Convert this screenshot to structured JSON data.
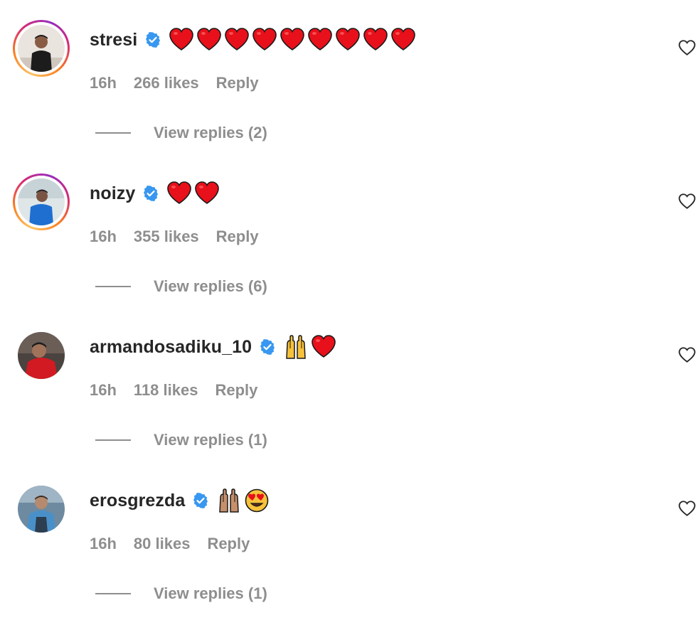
{
  "comments": [
    {
      "username": "stresi",
      "time": "16h",
      "likes": "266 likes",
      "reply": "Reply",
      "view_replies": "View replies (2)",
      "story_ring": true,
      "emojis": [
        "red-heart",
        "red-heart",
        "red-heart",
        "red-heart",
        "red-heart",
        "red-heart",
        "red-heart",
        "red-heart",
        "red-heart"
      ]
    },
    {
      "username": "noizy",
      "time": "16h",
      "likes": "355 likes",
      "reply": "Reply",
      "view_replies": "View replies (6)",
      "story_ring": true,
      "emojis": [
        "red-heart",
        "red-heart"
      ]
    },
    {
      "username": "armandosadiku_10",
      "time": "16h",
      "likes": "118 likes",
      "reply": "Reply",
      "view_replies": "View replies (1)",
      "story_ring": false,
      "emojis": [
        "raising-hands",
        "red-heart"
      ]
    },
    {
      "username": "erosgrezda",
      "time": "16h",
      "likes": "80 likes",
      "reply": "Reply",
      "view_replies": "View replies (1)",
      "story_ring": false,
      "emojis": [
        "raising-hands-medium-skin",
        "heart-eyes-face"
      ]
    }
  ],
  "colors": {
    "text": "#262626",
    "secondary": "#8e8e8e",
    "verified": "#3897f0",
    "heart": "#e8101a"
  }
}
